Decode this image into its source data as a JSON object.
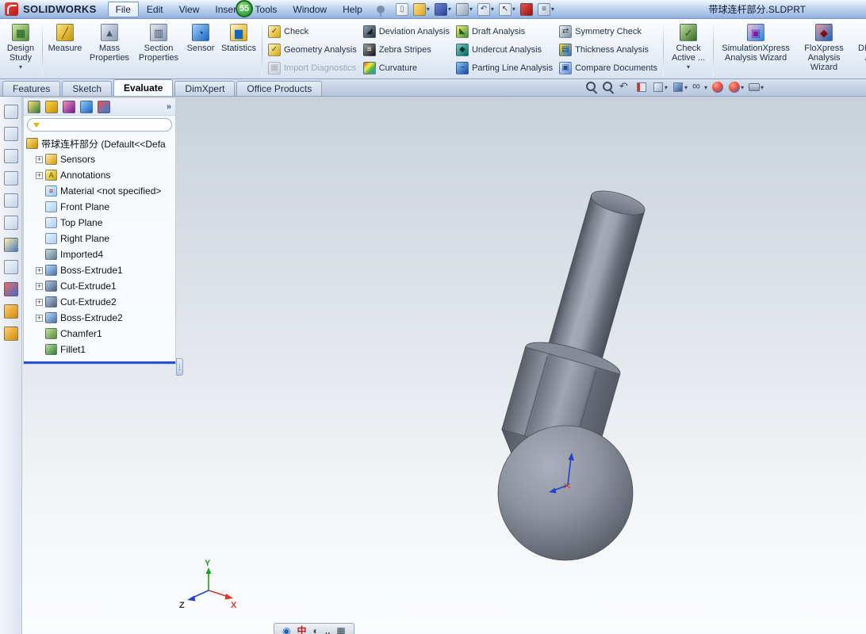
{
  "overlay": {
    "recording_badge": "55"
  },
  "glyphs": {
    "dropdown": "▾",
    "overflow": "»",
    "expander": "+"
  },
  "titlebar": {
    "app_name": "SOLIDWORKS",
    "document_title": "带球连杆部分.SLDPRT",
    "menus": [
      {
        "label": "File",
        "active": true
      },
      {
        "label": "Edit"
      },
      {
        "label": "View"
      },
      {
        "label": "Insert"
      },
      {
        "label": "Tools"
      },
      {
        "label": "Window"
      },
      {
        "label": "Help"
      }
    ],
    "toolbar": [
      {
        "icon": "new-document-icon",
        "glyph": "▯",
        "gc": "#5a6a84",
        "c1": "#ffffff",
        "c2": "#dbe3ef"
      },
      {
        "icon": "open-folder-icon",
        "c1": "#ffe082",
        "c2": "#d8a521",
        "dropdown": true
      },
      {
        "icon": "save-icon",
        "c1": "#6d86d8",
        "c2": "#2b3f8f",
        "dropdown": true
      },
      {
        "icon": "print-icon",
        "c1": "#e3e9f2",
        "c2": "#93a2b8",
        "dropdown": true
      },
      {
        "icon": "undo-icon",
        "glyph": "↶",
        "gc": "#2c4a85",
        "c1": "#f2f6fb",
        "c2": "#ccd7e6",
        "dropdown": true
      },
      {
        "icon": "select-arrow-icon",
        "glyph": "↖",
        "gc": "#2c3c5c",
        "c1": "#f6f9fc",
        "c2": "#d3dde9",
        "dropdown": true
      },
      {
        "icon": "rebuild-icon",
        "c1": "#ef5350",
        "c2": "#8e1410"
      },
      {
        "icon": "options-icon",
        "glyph": "≡",
        "gc": "#3c4c63",
        "c1": "#eef3fa",
        "c2": "#b9c6d8",
        "dropdown": true
      }
    ]
  },
  "ribbon": {
    "large_left": [
      {
        "label": "Design Study",
        "icon": "design-study-icon",
        "glyph": "▦",
        "gc": "#1b5e20",
        "c1": "#cde8a8",
        "c2": "#558b2f",
        "dropdown": true,
        "w": 48
      },
      {
        "label": "Measure",
        "icon": "measure-icon",
        "glyph": "╱",
        "gc": "#7a5600",
        "c1": "#ffe57f",
        "c2": "#c79100",
        "w": 50
      },
      {
        "label": "Mass Properties",
        "icon": "mass-properties-icon",
        "glyph": "▲",
        "gc": "#44556e",
        "c1": "#e3e9f2",
        "c2": "#8d9cb4",
        "w": 62
      },
      {
        "label": "Section Properties",
        "icon": "section-properties-icon",
        "glyph": "▥",
        "gc": "#44556e",
        "c1": "#e3e9f2",
        "c2": "#8d9cb4",
        "w": 62
      },
      {
        "label": "Sensor",
        "icon": "sensor-icon",
        "glyph": "◔",
        "gc": "#0d3c8c",
        "c1": "#a8d0f7",
        "c2": "#1565c0",
        "w": 44
      },
      {
        "label": "Statistics",
        "icon": "statistics-icon",
        "glyph": "▆",
        "gc": "#1565c0",
        "c1": "#fff3c4",
        "c2": "#e0a800",
        "w": 52
      }
    ],
    "small_columns": [
      [
        {
          "label": "Check",
          "icon": "check-icon",
          "glyph": "✓",
          "gc": "#8b2500",
          "c1": "#fff3c4",
          "c2": "#d7a700"
        },
        {
          "label": "Geometry Analysis",
          "icon": "geometry-analysis-icon",
          "glyph": "✓",
          "gc": "#1b5e20",
          "c1": "#fff3c4",
          "c2": "#d7a700"
        },
        {
          "label": "Import Diagnostics",
          "icon": "import-diagnostics-icon",
          "glyph": "▦",
          "gc": "#7d8696",
          "c1": "#f0f0f0",
          "c2": "#c2c2c2",
          "disabled": true
        }
      ],
      [
        {
          "label": "Deviation Analysis",
          "icon": "deviation-analysis-icon",
          "glyph": "◢",
          "gc": "#13202c",
          "c1": "#90a4ae",
          "c2": "#263238"
        },
        {
          "label": "Zebra Stripes",
          "icon": "zebra-stripes-icon",
          "glyph": "≡",
          "gc": "#ffffff",
          "c1": "#9e9e9e",
          "c2": "#111111"
        },
        {
          "label": "Curvature",
          "icon": "curvature-icon",
          "bg": "linear-gradient(135deg,#f44336,#ffeb3b 35%,#4caf50 65%,#2196f3)"
        }
      ],
      [
        {
          "label": "Draft Analysis",
          "icon": "draft-analysis-icon",
          "glyph": "◣",
          "gc": "#1b5e20",
          "c1": "#fff176",
          "c2": "#388e3c"
        },
        {
          "label": "Undercut Analysis",
          "icon": "undercut-analysis-icon",
          "glyph": "◆",
          "gc": "#00332c",
          "c1": "#80cbc4",
          "c2": "#00695c"
        },
        {
          "label": "Parting Line Analysis",
          "icon": "parting-line-analysis-icon",
          "glyph": "~",
          "gc": "#0a2f6b",
          "c1": "#90caf9",
          "c2": "#0d47a1"
        }
      ],
      [
        {
          "label": "Symmetry Check",
          "icon": "symmetry-check-icon",
          "glyph": "⇄",
          "gc": "#37474f",
          "c1": "#eceff1",
          "c2": "#78909c"
        },
        {
          "label": "Thickness Analysis",
          "icon": "thickness-analysis-icon",
          "glyph": "▤",
          "gc": "#0d47a1",
          "c1": "#ffd740",
          "c2": "#1976d2"
        },
        {
          "label": "Compare Documents",
          "icon": "compare-documents-icon",
          "glyph": "▣",
          "gc": "#2c4a85",
          "c1": "#e3f2fd",
          "c2": "#5c8ae6"
        }
      ]
    ],
    "large_right": [
      {
        "label": "Check Active ...",
        "icon": "check-active-icon",
        "glyph": "✓",
        "gc": "#1b5e20",
        "c1": "#c5e1a5",
        "c2": "#33691e",
        "dropdown": true,
        "w": 56
      },
      {
        "label": "SimulationXpress Analysis Wizard",
        "icon": "simulationxpress-wizard-icon",
        "glyph": "▣",
        "gc": "#7b1fa2",
        "c1": "#f8bbd0",
        "c2": "#1e88e5",
        "w": 100
      },
      {
        "label": "FloXpress Analysis Wizard",
        "icon": "floxpress-wizard-icon",
        "glyph": "◆",
        "gc": "#7f1010",
        "c1": "#ef9a9a",
        "c2": "#1565c0",
        "w": 72
      },
      {
        "label": "DFMXpress Analysis Wizard",
        "icon": "dfmxpress-wizard-icon",
        "glyph": "▣",
        "gc": "#1b5e20",
        "c1": "#a5d6a7",
        "c2": "#c62828",
        "w": 72
      }
    ]
  },
  "command_tabs": {
    "active": "Evaluate",
    "tabs": [
      "Features",
      "Sketch",
      "Evaluate",
      "DimXpert",
      "Office Products"
    ]
  },
  "headsup_toolbar": [
    {
      "icon": "zoom-to-fit-icon",
      "type": "magnifier"
    },
    {
      "icon": "zoom-to-area-icon",
      "type": "magnifier"
    },
    {
      "icon": "previous-view-icon",
      "type": "arrow"
    },
    {
      "icon": "section-view-icon",
      "type": "section"
    },
    {
      "icon": "view-orientation-icon",
      "type": "cube",
      "dropdown": true
    },
    {
      "icon": "display-style-icon",
      "type": "cube-shaded",
      "dropdown": true
    },
    {
      "icon": "hide-show-items-icon",
      "type": "glasses",
      "dropdown": true
    },
    {
      "icon": "edit-appearance-icon",
      "type": "ball"
    },
    {
      "icon": "apply-scene-icon",
      "type": "ball",
      "dropdown": true
    },
    {
      "icon": "view-settings-icon",
      "type": "camera",
      "dropdown": true
    }
  ],
  "side_toolbar": [
    {
      "icon": "document-stack-icon",
      "c1": "#f4f7fb",
      "c2": "#c6d2e2"
    },
    {
      "icon": "part-box-icon",
      "c1": "#f4f7fb",
      "c2": "#c6d2e2"
    },
    {
      "icon": "book-icon",
      "c1": "#f4f7fb",
      "c2": "#c6d2e2"
    },
    {
      "icon": "clipboard-icon",
      "c1": "#f4f7fb",
      "c2": "#c6d2e2"
    },
    {
      "icon": "cube-tool-icon",
      "c1": "#f4f7fb",
      "c2": "#c6d2e2"
    },
    {
      "icon": "outline-tool-icon",
      "c1": "#f4f7fb",
      "c2": "#c6d2e2"
    },
    {
      "icon": "sketch-pencil-icon",
      "c1": "#fff1a8",
      "c2": "#4a78c4"
    },
    {
      "icon": "dimension-tool-icon",
      "c1": "#f4f7fb",
      "c2": "#c6d2e2"
    },
    {
      "icon": "appearance-ball-icon",
      "c1": "#ef6a5a",
      "c2": "#3f6fd1"
    },
    {
      "icon": "decal-tool-icon",
      "c1": "#ffd27a",
      "c2": "#d08a00"
    },
    {
      "icon": "scene-tool-icon",
      "c1": "#ffd27a",
      "c2": "#d08a00"
    }
  ],
  "fm_panel": {
    "toolbar": [
      {
        "icon": "featuremanager-tab-icon",
        "c1": "#ffe082",
        "c2": "#2e7d32"
      },
      {
        "icon": "propertymanager-tab-icon",
        "c1": "#ffd54f",
        "c2": "#c79100"
      },
      {
        "icon": "configurationmanager-tab-icon",
        "c1": "#f48fb1",
        "c2": "#6a1b9a"
      },
      {
        "icon": "dimxpertmanager-tab-icon",
        "c1": "#90caf9",
        "c2": "#1565c0"
      },
      {
        "icon": "displaymanager-tab-icon",
        "c1": "#ef5350",
        "c2": "#1e88e5"
      }
    ],
    "filter": {
      "value": "",
      "placeholder": ""
    }
  },
  "feature_tree": {
    "root": {
      "label": "带球连杆部分 (Default<<Defa",
      "icon": "part-icon"
    },
    "items": [
      {
        "label": "Sensors",
        "icon": "sensors-folder-icon",
        "c1": "#ffecb3",
        "c2": "#d79b00",
        "expandable": true
      },
      {
        "label": "Annotations",
        "icon": "annotations-icon",
        "glyph": "A",
        "gc": "#6d4c00",
        "c1": "#fff59d",
        "c2": "#c7a500",
        "expandable": true
      },
      {
        "label": "Material <not specified>",
        "icon": "material-icon",
        "glyph": "≡",
        "gc": "#b71c1c",
        "c1": "#e3f2fd",
        "c2": "#90caf9"
      },
      {
        "label": "Front Plane",
        "icon": "front-plane-icon",
        "c1": "#eaf4fe",
        "c2": "#a9cdf2"
      },
      {
        "label": "Top Plane",
        "icon": "top-plane-icon",
        "c1": "#eaf4fe",
        "c2": "#a9cdf2"
      },
      {
        "label": "Right Plane",
        "icon": "right-plane-icon",
        "c1": "#eaf4fe",
        "c2": "#a9cdf2"
      },
      {
        "label": "Imported4",
        "icon": "imported-feature-icon",
        "c1": "#cfd8dc",
        "c2": "#607d8b"
      },
      {
        "label": "Boss-Extrude1",
        "icon": "boss-extrude-icon",
        "c1": "#bbdefb",
        "c2": "#4a6fa5",
        "expandable": true
      },
      {
        "label": "Cut-Extrude1",
        "icon": "cut-extrude-icon",
        "c1": "#b3c7e6",
        "c2": "#51607a",
        "expandable": true
      },
      {
        "label": "Cut-Extrude2",
        "icon": "cut-extrude-icon",
        "c1": "#b3c7e6",
        "c2": "#51607a",
        "expandable": true
      },
      {
        "label": "Boss-Extrude2",
        "icon": "boss-extrude-icon",
        "c1": "#bbdefb",
        "c2": "#4a6fa5",
        "expandable": true
      },
      {
        "label": "Chamfer1",
        "icon": "chamfer-icon",
        "c1": "#c5e1a5",
        "c2": "#558b2f"
      },
      {
        "label": "Fillet1",
        "icon": "fillet-icon",
        "c1": "#c5e1a5",
        "c2": "#2e7d32"
      }
    ]
  },
  "ime_bar": {
    "items": [
      {
        "icon": "input-method-logo-icon",
        "glyph": "◉",
        "color": "#1565c0"
      },
      {
        "icon": "chinese-english-toggle-icon",
        "glyph": "中",
        "color": "#b71c1c"
      },
      {
        "icon": "fullwidth-halfwidth-icon",
        "glyph": "◐",
        "color": "#37474f"
      },
      {
        "icon": "punctuation-icon",
        "glyph": ",.",
        "color": "#37474f"
      },
      {
        "icon": "soft-keyboard-icon",
        "glyph": "▦",
        "color": "#37474f"
      }
    ]
  },
  "model": {
    "part_color": "#8a909c",
    "edge_color": "#4b5058",
    "origin_color": "#2741c9",
    "axis_colors": {
      "x": "#d23a2e",
      "y": "#1e9e1e",
      "z": "#2741c9"
    },
    "axis_labels": {
      "x": "X",
      "y": "Y",
      "z": "Z"
    }
  }
}
